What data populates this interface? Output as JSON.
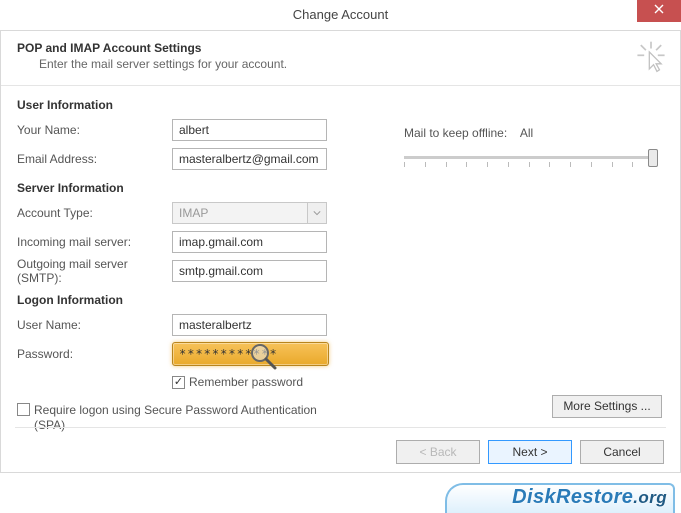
{
  "window": {
    "title": "Change Account"
  },
  "header": {
    "title": "POP and IMAP Account Settings",
    "subtitle": "Enter the mail server settings for your account."
  },
  "sections": {
    "user_info": "User Information",
    "server_info": "Server Information",
    "logon_info": "Logon Information"
  },
  "labels": {
    "your_name": "Your Name:",
    "email": "Email Address:",
    "account_type": "Account Type:",
    "incoming": "Incoming mail server:",
    "outgoing": "Outgoing mail server (SMTP):",
    "user_name": "User Name:",
    "password": "Password:",
    "remember": "Remember password",
    "spa": "Require logon using Secure Password Authentication (SPA)",
    "mail_keep": "Mail to keep offline:",
    "mail_keep_value": "All"
  },
  "values": {
    "your_name": "albert",
    "email": "masteralbertz@gmail.com",
    "account_type": "IMAP",
    "incoming": "imap.gmail.com",
    "outgoing": "smtp.gmail.com",
    "user_name": "masteralbertz",
    "password": "************"
  },
  "checks": {
    "remember": true,
    "spa": false
  },
  "buttons": {
    "more": "More Settings ...",
    "back": "< Back",
    "next": "Next >",
    "cancel": "Cancel"
  },
  "watermark": {
    "text1": "DiskRestore",
    "text2": ".org"
  }
}
